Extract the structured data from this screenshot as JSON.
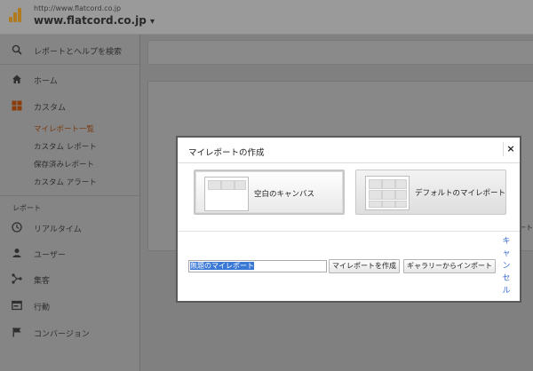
{
  "header": {
    "site_url": "http://www.flatcord.co.jp",
    "site_name": "www.flatcord.co.jp",
    "site_caret": "▾"
  },
  "sidebar": {
    "search_label": "レポートとヘルプを検索",
    "home_label": "ホーム",
    "custom_label": "カスタム",
    "sub_items": [
      "マイレポート一覧",
      "カスタム レポート",
      "保存済みレポート",
      "カスタム アラート"
    ],
    "reports_section": "レポート",
    "report_items": [
      "リアルタイム",
      "ユーザー",
      "集客",
      "行動",
      "コンバージョン"
    ]
  },
  "content": {
    "fragment_text": "ート"
  },
  "modal": {
    "title": "マイレポートの作成",
    "close_symbol": "×",
    "option_blank_label": "空白のキャンバス",
    "option_default_label": "デフォルトのマイレポート",
    "name_value": "無題のマイレポート",
    "create_button_label": "マイレポートを作成",
    "import_button_label": "ギャラリーからインポート",
    "cancel_label": "キャンセル"
  },
  "colors": {
    "accent_active": "#e8711a",
    "overlay": "#7e7e7e",
    "link": "#3b6fcf"
  }
}
